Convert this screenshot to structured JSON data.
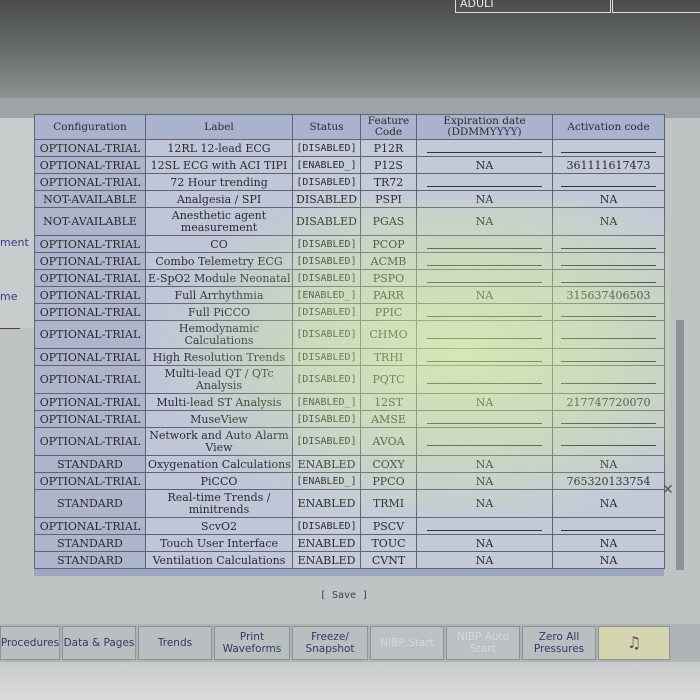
{
  "header": {
    "patient_category": "ADULT"
  },
  "side": {
    "label1": "ment",
    "label2": "me"
  },
  "table": {
    "headers": {
      "configuration": "Configuration",
      "label": "Label",
      "status": "Status",
      "feature_code": "Feature Code",
      "expiration_date": "Expiration date (DDMMYYYY)",
      "activation_code": "Activation code"
    },
    "rows": [
      {
        "configuration": "OPTIONAL-TRIAL",
        "label": "12RL 12-lead ECG",
        "status": "[DISABLED]",
        "code": "P12R",
        "expiration": "",
        "activation": ""
      },
      {
        "configuration": "OPTIONAL-TRIAL",
        "label": "12SL ECG with ACI TIPI",
        "status": "[ENABLED_]",
        "code": "P12S",
        "expiration": "NA",
        "activation": "361111617473"
      },
      {
        "configuration": "OPTIONAL-TRIAL",
        "label": "72 Hour trending",
        "status": "[DISABLED]",
        "code": "TR72",
        "expiration": "",
        "activation": ""
      },
      {
        "configuration": "NOT-AVAILABLE",
        "label": "Analgesia / SPI",
        "status": "DISABLED",
        "code": "PSPI",
        "expiration": "NA",
        "activation": "NA"
      },
      {
        "configuration": "NOT-AVAILABLE",
        "label": "Anesthetic agent measurement",
        "status": "DISABLED",
        "code": "PGAS",
        "expiration": "NA",
        "activation": "NA"
      },
      {
        "configuration": "OPTIONAL-TRIAL",
        "label": "CO",
        "status": "[DISABLED]",
        "code": "PCOP",
        "expiration": "",
        "activation": ""
      },
      {
        "configuration": "OPTIONAL-TRIAL",
        "label": "Combo Telemetry ECG",
        "status": "[DISABLED]",
        "code": "ACMB",
        "expiration": "",
        "activation": ""
      },
      {
        "configuration": "OPTIONAL-TRIAL",
        "label": "E-SpO2 Module Neonatal",
        "status": "[DISABLED]",
        "code": "PSPO",
        "expiration": "",
        "activation": ""
      },
      {
        "configuration": "OPTIONAL-TRIAL",
        "label": "Full Arrhythmia",
        "status": "[ENABLED_]",
        "code": "PARR",
        "expiration": "NA",
        "activation": "315637406503"
      },
      {
        "configuration": "OPTIONAL-TRIAL",
        "label": "Full PiCCO",
        "status": "[DISABLED]",
        "code": "PPIC",
        "expiration": "",
        "activation": ""
      },
      {
        "configuration": "OPTIONAL-TRIAL",
        "label": "Hemodynamic Calculations",
        "status": "[DISABLED]",
        "code": "CHMO",
        "expiration": "",
        "activation": ""
      },
      {
        "configuration": "OPTIONAL-TRIAL",
        "label": "High Resolution Trends",
        "status": "[DISABLED]",
        "code": "TRHI",
        "expiration": "",
        "activation": ""
      },
      {
        "configuration": "OPTIONAL-TRIAL",
        "label": "Multi-lead QT / QTc Analysis",
        "status": "[DISABLED]",
        "code": "PQTC",
        "expiration": "",
        "activation": ""
      },
      {
        "configuration": "OPTIONAL-TRIAL",
        "label": "Multi-lead ST Analysis",
        "status": "[ENABLED_]",
        "code": "12ST",
        "expiration": "NA",
        "activation": "217747720070"
      },
      {
        "configuration": "OPTIONAL-TRIAL",
        "label": "MuseView",
        "status": "[DISABLED]",
        "code": "AMSE",
        "expiration": "",
        "activation": ""
      },
      {
        "configuration": "OPTIONAL-TRIAL",
        "label": "Network and Auto Alarm View",
        "status": "[DISABLED]",
        "code": "AVOA",
        "expiration": "",
        "activation": ""
      },
      {
        "configuration": "STANDARD",
        "label": "Oxygenation Calculations",
        "status": "ENABLED",
        "code": "COXY",
        "expiration": "NA",
        "activation": "NA"
      },
      {
        "configuration": "OPTIONAL-TRIAL",
        "label": "PiCCO",
        "status": "[ENABLED_]",
        "code": "PPCO",
        "expiration": "NA",
        "activation": "765320133754"
      },
      {
        "configuration": "STANDARD",
        "label": "Real-time Trends / minitrends",
        "status": "ENABLED",
        "code": "TRMI",
        "expiration": "NA",
        "activation": "NA"
      },
      {
        "configuration": "OPTIONAL-TRIAL",
        "label": "ScvO2",
        "status": "[DISABLED]",
        "code": "PSCV",
        "expiration": "",
        "activation": ""
      },
      {
        "configuration": "STANDARD",
        "label": "Touch User Interface",
        "status": "ENABLED",
        "code": "TOUC",
        "expiration": "NA",
        "activation": "NA"
      },
      {
        "configuration": "STANDARD",
        "label": "Ventilation Calculations",
        "status": "ENABLED",
        "code": "CVNT",
        "expiration": "NA",
        "activation": "NA"
      }
    ]
  },
  "save_label": "[ Save ]",
  "bottom_buttons": [
    {
      "label": "Procedures",
      "enabled": true
    },
    {
      "label": "Data & Pages",
      "enabled": true
    },
    {
      "label": "Trends",
      "enabled": true
    },
    {
      "label": "Print Waveforms",
      "enabled": true
    },
    {
      "label": "Freeze/ Snapshot",
      "enabled": true
    },
    {
      "label": "NIBP Start",
      "enabled": false
    },
    {
      "label": "NIBP Auto Start",
      "enabled": false
    },
    {
      "label": "Zero All Pressures",
      "enabled": true
    }
  ],
  "alarm_icon": "alarm-bell-icon",
  "colors": {
    "text_blue": "#303a66",
    "table_bg": "#c0c6d8",
    "glare": "#e6ff96"
  }
}
